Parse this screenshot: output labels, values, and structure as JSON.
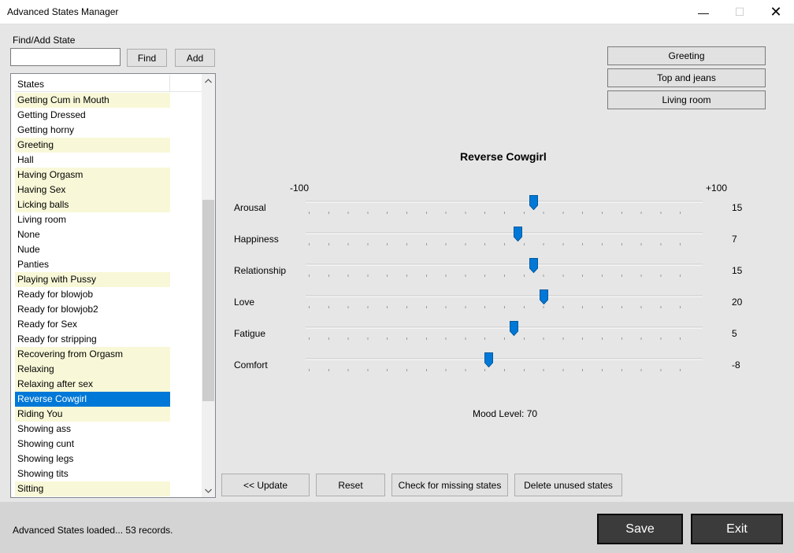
{
  "window": {
    "title": "Advanced States Manager",
    "minimize_glyph": "—",
    "maximize_glyph": "☐",
    "close_glyph": "✕"
  },
  "search": {
    "label": "Find/Add State",
    "value": "",
    "placeholder": "",
    "find_label": "Find",
    "add_label": "Add"
  },
  "states_list": {
    "header": "States",
    "items": [
      {
        "label": "Getting Cum in Mouth",
        "highlight": true,
        "selected": false
      },
      {
        "label": "Getting Dressed",
        "highlight": false,
        "selected": false
      },
      {
        "label": "Getting horny",
        "highlight": false,
        "selected": false
      },
      {
        "label": "Greeting",
        "highlight": true,
        "selected": false
      },
      {
        "label": "Hall",
        "highlight": false,
        "selected": false
      },
      {
        "label": "Having Orgasm",
        "highlight": true,
        "selected": false
      },
      {
        "label": "Having Sex",
        "highlight": true,
        "selected": false
      },
      {
        "label": "Licking balls",
        "highlight": true,
        "selected": false
      },
      {
        "label": "Living room",
        "highlight": false,
        "selected": false
      },
      {
        "label": "None",
        "highlight": false,
        "selected": false
      },
      {
        "label": "Nude",
        "highlight": false,
        "selected": false
      },
      {
        "label": "Panties",
        "highlight": false,
        "selected": false
      },
      {
        "label": "Playing with Pussy",
        "highlight": true,
        "selected": false
      },
      {
        "label": "Ready for blowjob",
        "highlight": false,
        "selected": false
      },
      {
        "label": "Ready for blowjob2",
        "highlight": false,
        "selected": false
      },
      {
        "label": "Ready for Sex",
        "highlight": false,
        "selected": false
      },
      {
        "label": "Ready for stripping",
        "highlight": false,
        "selected": false
      },
      {
        "label": "Recovering from Orgasm",
        "highlight": true,
        "selected": false
      },
      {
        "label": "Relaxing",
        "highlight": true,
        "selected": false
      },
      {
        "label": "Relaxing after sex",
        "highlight": true,
        "selected": false
      },
      {
        "label": "Reverse Cowgirl",
        "highlight": true,
        "selected": true
      },
      {
        "label": "Riding You",
        "highlight": true,
        "selected": false
      },
      {
        "label": "Showing ass",
        "highlight": false,
        "selected": false
      },
      {
        "label": "Showing cunt",
        "highlight": false,
        "selected": false
      },
      {
        "label": "Showing legs",
        "highlight": false,
        "selected": false
      },
      {
        "label": "Showing tits",
        "highlight": false,
        "selected": false
      },
      {
        "label": "Sitting",
        "highlight": true,
        "selected": false
      }
    ]
  },
  "quick_buttons": [
    "Greeting",
    "Top and jeans",
    "Living room"
  ],
  "editor": {
    "state_name": "Reverse Cowgirl",
    "range_min_label": "-100",
    "range_max_label": "+100",
    "range": [
      -100,
      100
    ],
    "sliders": [
      {
        "label": "Arousal",
        "value": 15
      },
      {
        "label": "Happiness",
        "value": 7
      },
      {
        "label": "Relationship",
        "value": 15
      },
      {
        "label": "Love",
        "value": 20
      },
      {
        "label": "Fatigue",
        "value": 5
      },
      {
        "label": "Comfort",
        "value": -8
      }
    ],
    "mood_text": "Mood Level: 70"
  },
  "actions": {
    "update": "<< Update",
    "reset": "Reset",
    "check_missing": "Check for missing states",
    "delete_unused": "Delete unused states"
  },
  "footer": {
    "status": "Advanced States loaded... 53 records.",
    "save": "Save",
    "exit": "Exit"
  },
  "colors": {
    "highlight_row": "#f8f8d8",
    "selected_row": "#0078d7",
    "slider_thumb": "#0078d7",
    "dark_button": "#3b3b3b"
  }
}
